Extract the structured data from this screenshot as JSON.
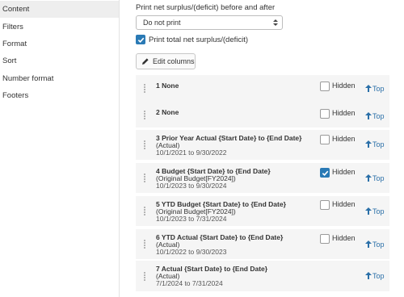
{
  "sidebar": {
    "items": [
      {
        "label": "Content",
        "active": true
      },
      {
        "label": "Filters",
        "active": false
      },
      {
        "label": "Format",
        "active": false
      },
      {
        "label": "Sort",
        "active": false
      },
      {
        "label": "Number format",
        "active": false
      },
      {
        "label": "Footers",
        "active": false
      }
    ]
  },
  "main": {
    "net_label": "Print net surplus/(deficit) before and after",
    "net_select_value": "Do not print",
    "print_total_label": "Print total net surplus/(deficit)",
    "print_total_checked": true,
    "edit_columns_label": "Edit columns",
    "hidden_label": "Hidden",
    "top_label": "Top",
    "columns": [
      {
        "title": "1 None",
        "sub": "",
        "dates": "",
        "hidden": false
      },
      {
        "title": "2 None",
        "sub": "",
        "dates": "",
        "hidden": false
      },
      {
        "title": "3 Prior Year Actual {Start Date} to {End Date}",
        "sub": "(Actual)",
        "dates": "10/1/2021 to 9/30/2022",
        "hidden": false
      },
      {
        "title": "4 Budget {Start Date} to {End Date}",
        "sub": "(Original Budget[FY2024])",
        "dates": "10/1/2023 to 9/30/2024",
        "hidden": true
      },
      {
        "title": "5 YTD Budget {Start Date} to {End Date}",
        "sub": "(Original Budget[FY2024])",
        "dates": "10/1/2023 to 7/31/2024",
        "hidden": false
      },
      {
        "title": "6 YTD Actual {Start Date} to {End Date}",
        "sub": "(Actual)",
        "dates": "10/1/2022 to 9/30/2023",
        "hidden": false
      },
      {
        "title": "7 Actual {Start Date} to {End Date}",
        "sub": "(Actual)",
        "dates": "7/1/2024 to 7/31/2024",
        "hidden": false
      }
    ]
  },
  "colors": {
    "accent": "#2a7ab5",
    "link": "#2a6fa8",
    "row_bg": "#f5f5f5",
    "active_nav_bg": "#eeeeee"
  }
}
